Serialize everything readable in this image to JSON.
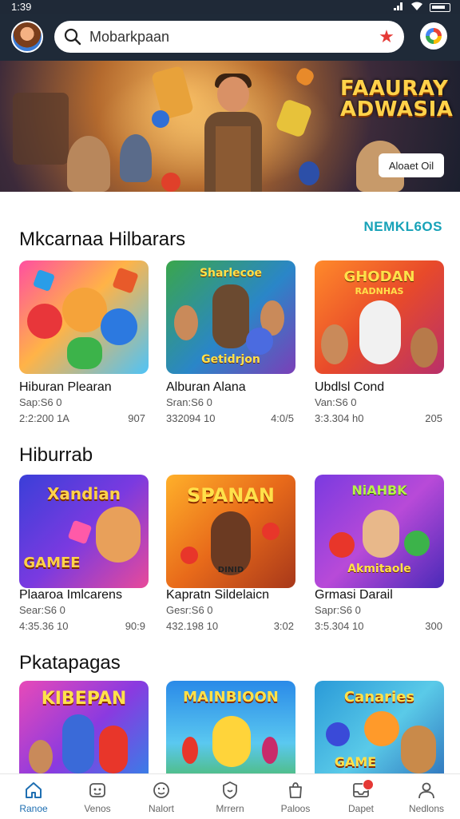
{
  "status": {
    "time": "1:39"
  },
  "search": {
    "value": "Mobarkpaan"
  },
  "banner": {
    "title": "FAAURAY ADWASIA",
    "button": "Aloaet Oil"
  },
  "sections": [
    {
      "title": "Mkcarnaa Hilbarars",
      "link": "NEMKL6OS",
      "games": [
        {
          "art": "",
          "title": "Hiburan Plearan",
          "sub": "Sap:S6 0",
          "meta": "2:2:200 1A",
          "score": "907"
        },
        {
          "art": "Sharlecoe",
          "art2": "Getidrjon",
          "title": "Alburan Alana",
          "sub": "Sran:S6 0",
          "meta": "332094 10",
          "score": "4:0/5"
        },
        {
          "art": "GHODAN",
          "art2": "RADNHAS",
          "title": "Ubdlsl Cond",
          "sub": "Van:S6 0",
          "meta": "3:3.304 h0",
          "score": "205"
        }
      ]
    },
    {
      "title": "Hiburrab",
      "link": "",
      "games": [
        {
          "art": "Xandian",
          "art2": "GAMEE",
          "title": "Plaaroa Imlcarens",
          "sub": "Sear:S6 0",
          "meta": "4:35.36 10",
          "score": "90:9"
        },
        {
          "art": "SPANAN",
          "art2": "DINID",
          "title": "Kapratn Sildelaicn",
          "sub": "Gesr:S6 0",
          "meta": "432.198 10",
          "score": "3:02"
        },
        {
          "art": "NiAHBK",
          "art2": "Akmitaole",
          "title": "Grmasi Darail",
          "sub": "Sapr:S6 0",
          "meta": "3:5.304 10",
          "score": "300"
        }
      ]
    },
    {
      "title": "Pkatapagas",
      "link": "",
      "games": [
        {
          "art": "KIBEPAN",
          "art2": "",
          "title": "",
          "sub": "",
          "meta": "",
          "score": ""
        },
        {
          "art": "MAINBIOON",
          "art2": "",
          "title": "",
          "sub": "",
          "meta": "",
          "score": ""
        },
        {
          "art": "Canaries",
          "art2": "GAME",
          "title": "",
          "sub": "",
          "meta": "",
          "score": ""
        }
      ]
    }
  ],
  "nav": [
    {
      "label": "Ranoe",
      "icon": "home-icon",
      "active": true
    },
    {
      "label": "Venos",
      "icon": "gamepad-icon",
      "active": false
    },
    {
      "label": "Nalort",
      "icon": "smiley-icon",
      "active": false
    },
    {
      "label": "Mrrern",
      "icon": "shield-icon",
      "active": false
    },
    {
      "label": "Paloos",
      "icon": "bag-icon",
      "active": false
    },
    {
      "label": "Dapet",
      "icon": "inbox-icon",
      "active": false
    },
    {
      "label": "Nedlons",
      "icon": "person-icon",
      "active": false
    }
  ],
  "colors": {
    "accent": "#1f6fb2",
    "link": "#17a2b8",
    "header": "#1f2a38"
  }
}
